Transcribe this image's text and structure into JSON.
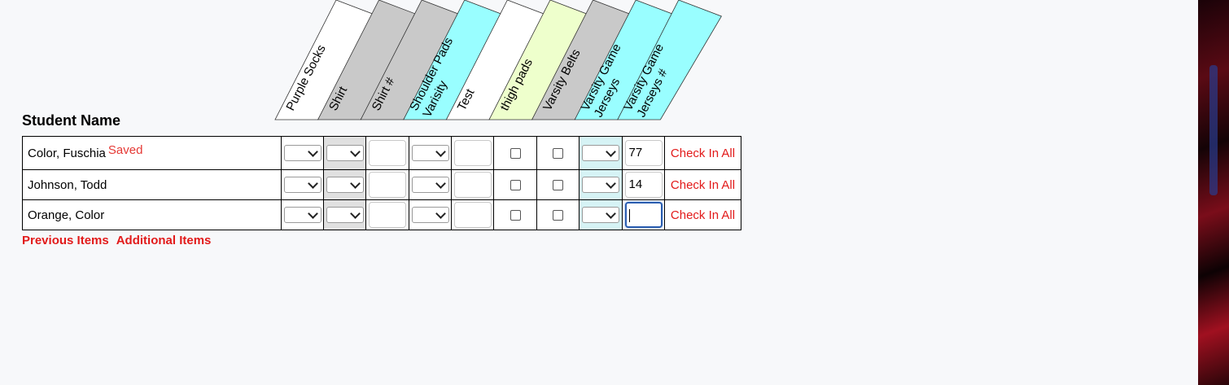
{
  "table": {
    "student_name_header": "Student Name",
    "columns": [
      {
        "lines": [
          "Purple Socks"
        ],
        "color": "#ffffff"
      },
      {
        "lines": [
          "Shirt"
        ],
        "color": "#c9c9c9"
      },
      {
        "lines": [
          "Shirt #"
        ],
        "color": "#c9c9c9"
      },
      {
        "lines": [
          "Shoulder Pads",
          "Varisity"
        ],
        "color": "#99feff"
      },
      {
        "lines": [
          "Test"
        ],
        "color": "#ffffff"
      },
      {
        "lines": [
          "thigh pads"
        ],
        "color": "#eeffcc"
      },
      {
        "lines": [
          "Varsity Belts"
        ],
        "color": "#c9c9c9"
      },
      {
        "lines": [
          "Varsity Game",
          "Jerseys"
        ],
        "color": "#99feff"
      },
      {
        "lines": [
          "Varsity Game",
          "Jerseys #"
        ],
        "color": "#99feff"
      }
    ],
    "rows": [
      {
        "name": "Color, Fuschia",
        "status": "Saved",
        "jersey_number": "77",
        "check_in_label": "Check In All"
      },
      {
        "name": "Johnson, Todd",
        "status": "",
        "jersey_number": "14",
        "check_in_label": "Check In All"
      },
      {
        "name": "Orange, Color",
        "status": "",
        "jersey_number": "",
        "check_in_label": "Check In All"
      }
    ]
  },
  "footer": {
    "previous_items": "Previous Items",
    "additional_items": "Additional Items"
  },
  "colors": {
    "accent_red": "#e21a1a",
    "saved_red": "#e53935",
    "focus_blue": "#2a5db0"
  }
}
